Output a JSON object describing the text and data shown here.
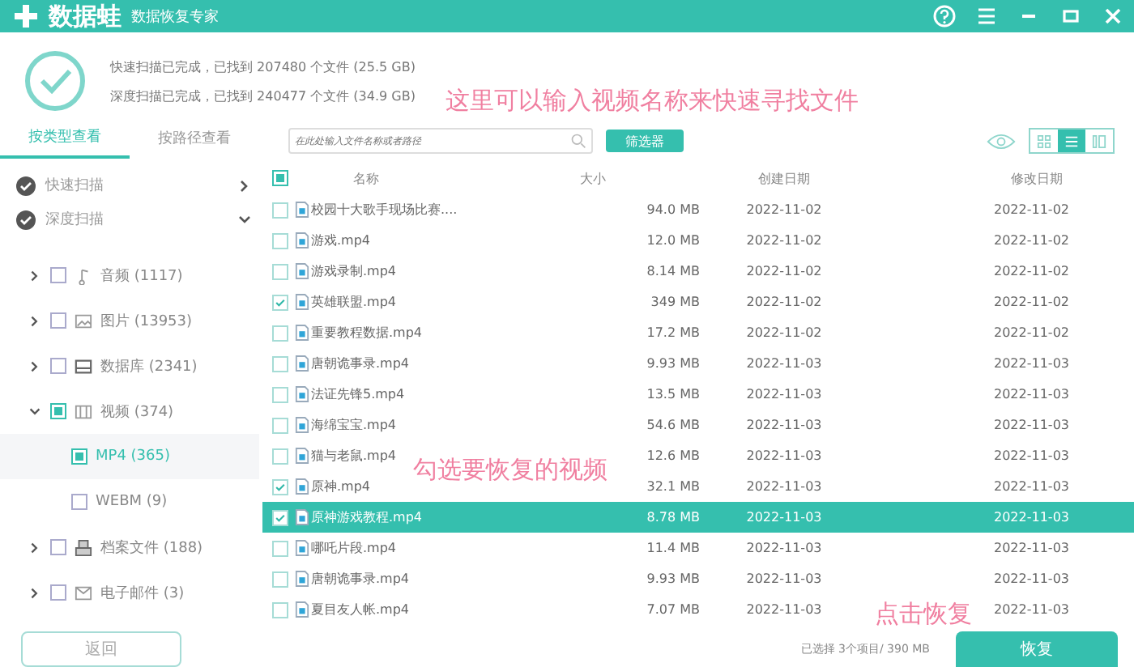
{
  "window": {
    "logo": "数据蛙",
    "subtitle": "数据恢复专家"
  },
  "summary": [
    "快速扫描已完成，已找到 207480 个文件 (25.5 GB)",
    "深度扫描已完成，已找到 240477 个文件 (34.9 GB)"
  ],
  "tabs": [
    {
      "label": "按类型查看",
      "selected": true
    },
    {
      "label": "按路径查看",
      "selected": false
    }
  ],
  "search": {
    "placeholder": "在此处输入文件名称或者路径"
  },
  "filter_button": "筛选器",
  "views": [
    {
      "kind": "grid",
      "selected": false
    },
    {
      "kind": "list",
      "selected": true
    },
    {
      "kind": "detail",
      "selected": false
    }
  ],
  "scans": [
    {
      "label": "快速扫描",
      "expanded": false
    },
    {
      "label": "深度扫描",
      "expanded": true
    }
  ],
  "tree": [
    {
      "label": "音频 (1117)",
      "kind": "audio",
      "expanded": false,
      "checked": false
    },
    {
      "label": "图片 (13953)",
      "kind": "image",
      "expanded": false,
      "checked": false
    },
    {
      "label": "数据库 (2341)",
      "kind": "database",
      "expanded": false,
      "checked": false
    },
    {
      "label": "视频 (374)",
      "kind": "video",
      "expanded": true,
      "checked": true,
      "children": [
        {
          "label": "MP4 (365)",
          "checked": true,
          "selected": true
        },
        {
          "label": "WEBM (9)",
          "checked": false,
          "selected": false
        }
      ]
    },
    {
      "label": "档案文件 (188)",
      "kind": "archive",
      "expanded": false,
      "checked": false
    },
    {
      "label": "电子邮件 (3)",
      "kind": "mail",
      "expanded": false,
      "checked": false
    }
  ],
  "back_button": "返回",
  "table": {
    "header_checked": true,
    "columns": [
      "名称",
      "大小",
      "创建日期",
      "修改日期"
    ],
    "rows": [
      {
        "name": "校园十大歌手现场比赛....",
        "size": "94.0 MB",
        "created": "2022-11-02",
        "modified": "2022-11-02",
        "checked": false,
        "selected": false
      },
      {
        "name": "游戏.mp4",
        "size": "12.0 MB",
        "created": "2022-11-02",
        "modified": "2022-11-02",
        "checked": false,
        "selected": false
      },
      {
        "name": "游戏录制.mp4",
        "size": "8.14 MB",
        "created": "2022-11-02",
        "modified": "2022-11-02",
        "checked": false,
        "selected": false
      },
      {
        "name": "英雄联盟.mp4",
        "size": "349 MB",
        "created": "2022-11-02",
        "modified": "2022-11-02",
        "checked": true,
        "selected": false
      },
      {
        "name": "重要教程数据.mp4",
        "size": "17.2 MB",
        "created": "2022-11-02",
        "modified": "2022-11-02",
        "checked": false,
        "selected": false
      },
      {
        "name": "唐朝诡事录.mp4",
        "size": "9.93 MB",
        "created": "2022-11-03",
        "modified": "2022-11-03",
        "checked": false,
        "selected": false
      },
      {
        "name": "法证先锋5.mp4",
        "size": "13.5 MB",
        "created": "2022-11-03",
        "modified": "2022-11-03",
        "checked": false,
        "selected": false
      },
      {
        "name": "海绵宝宝.mp4",
        "size": "54.6 MB",
        "created": "2022-11-03",
        "modified": "2022-11-03",
        "checked": false,
        "selected": false
      },
      {
        "name": "猫与老鼠.mp4",
        "size": "12.6 MB",
        "created": "2022-11-03",
        "modified": "2022-11-03",
        "checked": false,
        "selected": false
      },
      {
        "name": "原神.mp4",
        "size": "32.1 MB",
        "created": "2022-11-03",
        "modified": "2022-11-03",
        "checked": true,
        "selected": false
      },
      {
        "name": "原神游戏教程.mp4",
        "size": "8.78 MB",
        "created": "2022-11-03",
        "modified": "2022-11-03",
        "checked": true,
        "selected": true
      },
      {
        "name": "哪吒片段.mp4",
        "size": "11.4 MB",
        "created": "2022-11-03",
        "modified": "2022-11-03",
        "checked": false,
        "selected": false
      },
      {
        "name": "唐朝诡事录.mp4",
        "size": "9.93 MB",
        "created": "2022-11-03",
        "modified": "2022-11-03",
        "checked": false,
        "selected": false
      },
      {
        "name": "夏目友人帐.mp4",
        "size": "7.07 MB",
        "created": "2022-11-03",
        "modified": "2022-11-03",
        "checked": false,
        "selected": false
      }
    ]
  },
  "selection_status": "已选择 3个项目/ 390 MB",
  "recover_button": "恢复",
  "annotations": [
    "这里可以输入视频名称来快速寻找文件",
    "勾选要恢复的视频",
    "点击恢复"
  ]
}
